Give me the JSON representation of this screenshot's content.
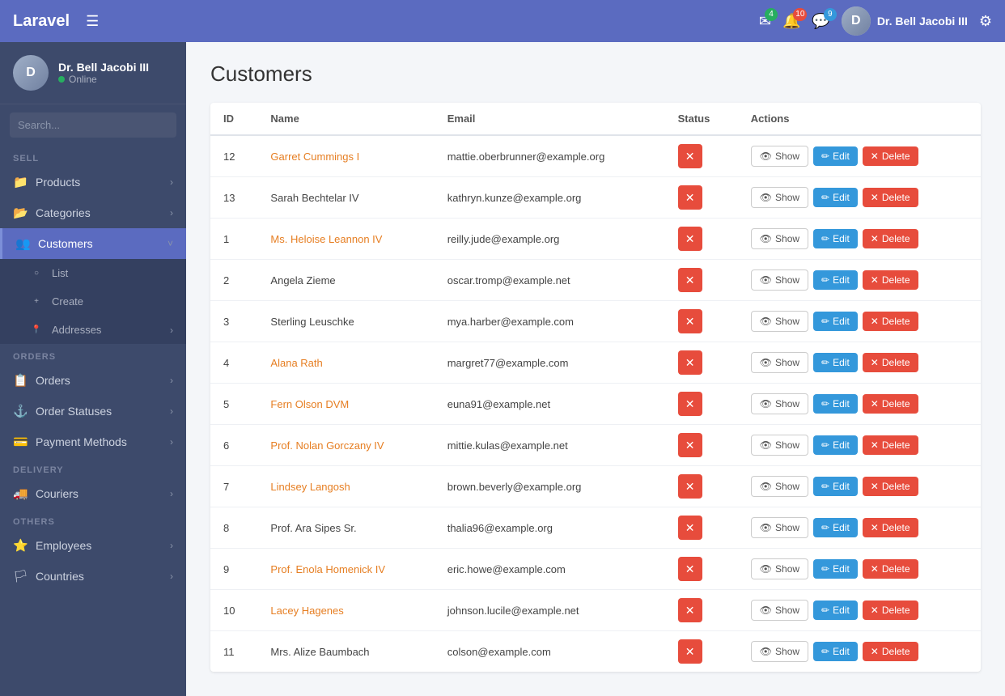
{
  "brand": "Laravel",
  "topnav": {
    "menu_icon": "☰",
    "badges": {
      "mail": "4",
      "bell": "10",
      "chat": "9"
    },
    "user_name": "Dr. Bell Jacobi III",
    "settings_icon": "⚙"
  },
  "sidebar": {
    "user": {
      "name": "Dr. Bell Jacobi III",
      "status": "Online"
    },
    "search_placeholder": "Search...",
    "sections": [
      {
        "label": "SELL",
        "items": [
          {
            "id": "products",
            "icon": "📁",
            "label": "Products",
            "arrow": true,
            "active": false
          },
          {
            "id": "categories",
            "icon": "📂",
            "label": "Categories",
            "arrow": true,
            "active": false
          },
          {
            "id": "customers",
            "icon": "👥",
            "label": "Customers",
            "arrow": true,
            "active": true,
            "sub": [
              {
                "id": "list",
                "icon": "○",
                "label": "List",
                "active": false
              },
              {
                "id": "create",
                "icon": "+",
                "label": "Create",
                "active": false
              },
              {
                "id": "addresses",
                "icon": "📍",
                "label": "Addresses",
                "arrow": true,
                "active": false
              }
            ]
          }
        ]
      },
      {
        "label": "ORDERS",
        "items": [
          {
            "id": "orders",
            "icon": "📋",
            "label": "Orders",
            "arrow": true,
            "active": false
          },
          {
            "id": "order-statuses",
            "icon": "⚓",
            "label": "Order Statuses",
            "arrow": true,
            "active": false
          },
          {
            "id": "payment-methods",
            "icon": "💳",
            "label": "Payment Methods",
            "arrow": true,
            "active": false
          }
        ]
      },
      {
        "label": "DELIVERY",
        "items": [
          {
            "id": "couriers",
            "icon": "🚚",
            "label": "Couriers",
            "arrow": true,
            "active": false
          }
        ]
      },
      {
        "label": "OTHERS",
        "items": [
          {
            "id": "employees",
            "icon": "⭐",
            "label": "Employees",
            "arrow": true,
            "active": false
          },
          {
            "id": "countries",
            "icon": "🏳",
            "label": "Countries",
            "arrow": true,
            "active": false
          }
        ]
      }
    ]
  },
  "page": {
    "title": "Customers",
    "table": {
      "columns": [
        "ID",
        "Name",
        "Email",
        "Status",
        "Actions"
      ],
      "rows": [
        {
          "id": "12",
          "name": "Garret Cummings I",
          "name_link": true,
          "email": "mattie.oberbrunner@example.org",
          "status": "inactive"
        },
        {
          "id": "13",
          "name": "Sarah Bechtelar IV",
          "name_link": false,
          "email": "kathryn.kunze@example.org",
          "status": "inactive"
        },
        {
          "id": "1",
          "name": "Ms. Heloise Leannon IV",
          "name_link": true,
          "email": "reilly.jude@example.org",
          "status": "inactive"
        },
        {
          "id": "2",
          "name": "Angela Zieme",
          "name_link": false,
          "email": "oscar.tromp@example.net",
          "status": "inactive"
        },
        {
          "id": "3",
          "name": "Sterling Leuschke",
          "name_link": false,
          "email": "mya.harber@example.com",
          "status": "inactive"
        },
        {
          "id": "4",
          "name": "Alana Rath",
          "name_link": true,
          "email": "margret77@example.com",
          "status": "inactive"
        },
        {
          "id": "5",
          "name": "Fern Olson DVM",
          "name_link": true,
          "email": "euna91@example.net",
          "status": "inactive"
        },
        {
          "id": "6",
          "name": "Prof. Nolan Gorczany IV",
          "name_link": true,
          "email": "mittie.kulas@example.net",
          "status": "inactive"
        },
        {
          "id": "7",
          "name": "Lindsey Langosh",
          "name_link": true,
          "email": "brown.beverly@example.org",
          "status": "inactive"
        },
        {
          "id": "8",
          "name": "Prof. Ara Sipes Sr.",
          "name_link": false,
          "email": "thalia96@example.org",
          "status": "inactive"
        },
        {
          "id": "9",
          "name": "Prof. Enola Homenick IV",
          "name_link": true,
          "email": "eric.howe@example.com",
          "status": "inactive"
        },
        {
          "id": "10",
          "name": "Lacey Hagenes",
          "name_link": true,
          "email": "johnson.lucile@example.net",
          "status": "inactive"
        },
        {
          "id": "11",
          "name": "Mrs. Alize Baumbach",
          "name_link": false,
          "email": "colson@example.com",
          "status": "inactive"
        }
      ]
    }
  },
  "buttons": {
    "show": "Show",
    "edit": "Edit",
    "delete": "Delete"
  }
}
